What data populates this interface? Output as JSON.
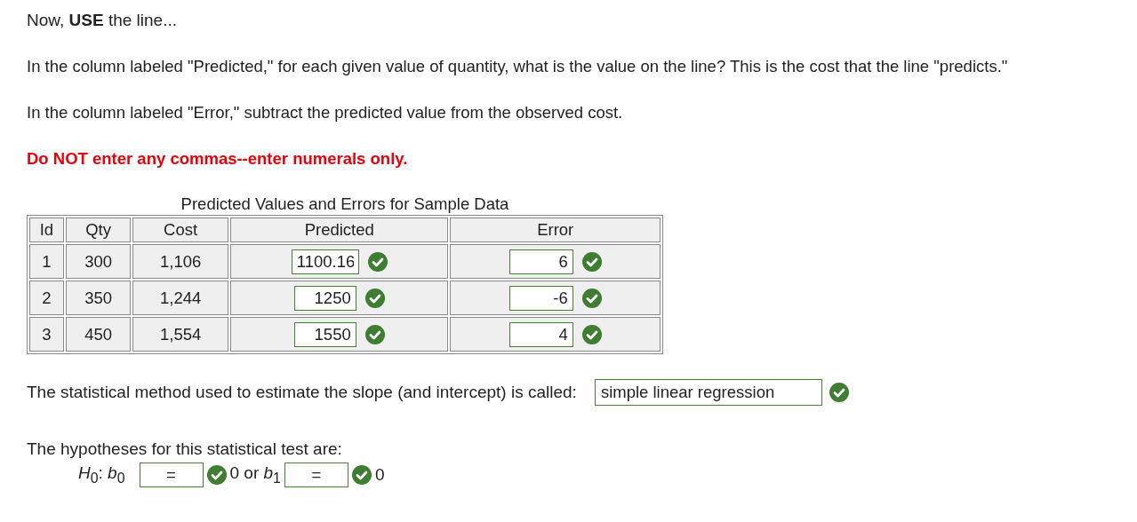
{
  "intro": "Now, **USE** the line...",
  "paragraphs": [
    "In the column labeled \"Predicted,\" for each given value of quantity, what is the value on the line?  This is the cost that the line \"predicts.\"",
    "In the column labeled \"Error,\" subtract the predicted value from the observed cost."
  ],
  "warning": "Do NOT enter any commas--enter numerals only.",
  "table": {
    "title": "Predicted Values and Errors for Sample Data",
    "columns": [
      "Id",
      "Qty",
      "Cost",
      "Predicted",
      "Error"
    ],
    "rows": [
      {
        "id": "1",
        "qty": "300",
        "cost": "1,106",
        "predicted": {
          "value": "1100.16",
          "correct": true
        },
        "error": {
          "value": "6",
          "correct": true
        }
      },
      {
        "id": "2",
        "qty": "350",
        "cost": "1,244",
        "predicted": {
          "value": "1250",
          "correct": true
        },
        "error": {
          "value": "-6",
          "correct": true
        }
      },
      {
        "id": "3",
        "qty": "450",
        "cost": "1,554",
        "predicted": {
          "value": "1550",
          "correct": true
        },
        "error": {
          "value": "4",
          "correct": true
        }
      }
    ]
  },
  "method": {
    "label": "The statistical method used to estimate the slope (and intercept) is called:",
    "answer": {
      "value": "simple linear regression",
      "correct": true
    }
  },
  "hypotheses": {
    "label": "The hypotheses for this statistical test are:",
    "h0_label": "*H*$_{0}$: *b*$_{0}$",
    "field_1": {
      "value": "=",
      "correct": true
    },
    "middle": "0 or *b*$_{1}$",
    "field_2": {
      "value": "=",
      "correct": true
    },
    "end": "0"
  }
}
